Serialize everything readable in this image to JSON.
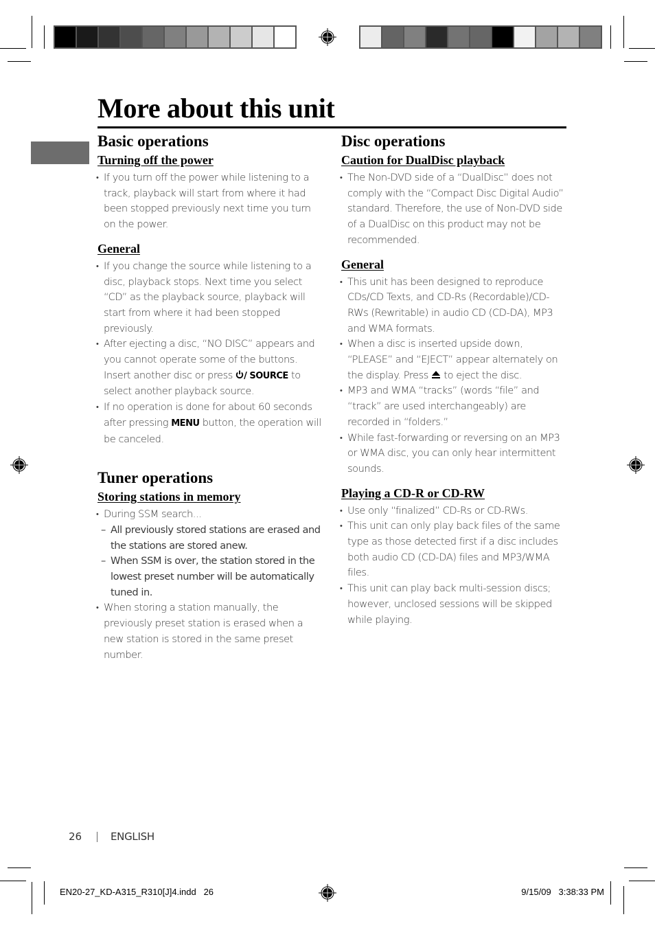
{
  "page": {
    "title": "More about this unit",
    "footer": {
      "page_number": "26",
      "language": "ENGLISH"
    },
    "slug": {
      "file": "EN20-27_KD-A315_R310[J]4.indd   26",
      "timestamp": "9/15/09   3:38:33 PM"
    }
  },
  "colorbars": {
    "left": [
      "#000000",
      "#1a1a1a",
      "#333333",
      "#4d4d4d",
      "#666666",
      "#808080",
      "#999999",
      "#b3b3b3",
      "#cccccc",
      "#e6e6e6",
      "#ffffff"
    ],
    "right": [
      "#ececec",
      "#646464",
      "#808080",
      "#2a2a2a",
      "#737373",
      "#666666",
      "#000000",
      "#f2f2f2",
      "#a3a3a3",
      "#b3b3b3",
      "#808080"
    ]
  },
  "left_column": {
    "basic": {
      "heading": "Basic operations",
      "turning_off": {
        "subheading": "Turning off the power",
        "items": [
          "If you turn off the power while listening to a track, playback will start from where it had been stopped previously next time you turn on the power."
        ]
      },
      "general": {
        "subheading": "General",
        "item1": "If you change the source while listening to a disc, playback stops. Next time you select “CD” as the playback source, playback will start from where it had been stopped previously.",
        "item2_pre": "After ejecting a disc, “NO DISC” appears and you cannot operate some of the buttons. Insert another disc or press ",
        "item2_icon": "power-icon",
        "item2_key": "/ SOURCE",
        "item2_post": " to select another playback source.",
        "item3_pre": "If no operation is done for about 60 seconds after pressing ",
        "item3_key": "MENU",
        "item3_post": " button, the operation will be canceled."
      }
    },
    "tuner": {
      "heading": "Tuner operations",
      "storing": {
        "subheading": "Storing stations in memory",
        "item1": "During SSM search...",
        "sub1": "All previously stored stations are erased and the stations are stored anew.",
        "sub2": "When SSM is over, the station stored in the lowest preset number will be automatically tuned in.",
        "item2": "When storing a station manually, the previously preset station is erased when a new station is stored in the same preset number."
      }
    }
  },
  "right_column": {
    "disc": {
      "heading": "Disc operations",
      "caution": {
        "subheading": "Caution for DualDisc playback",
        "items": [
          "The Non-DVD side of a “DualDisc” does not comply with the “Compact Disc Digital Audio” standard. Therefore, the use of Non-DVD side of a DualDisc on this product may not be recommended."
        ]
      },
      "general": {
        "subheading": "General",
        "item1": "This unit has been designed to reproduce CDs/CD Texts, and CD-Rs (Recordable)/CD-RWs (Rewritable) in audio CD (CD-DA), MP3 and WMA formats.",
        "item2_pre": "When a disc is inserted upside down, “PLEASE” and “EJECT” appear alternately on the display. Press ",
        "item2_icon": "eject-icon",
        "item2_post": " to eject the disc.",
        "item3": "MP3 and WMA “tracks” (words “file” and “track” are used interchangeably) are recorded in “folders.”",
        "item4": "While fast-forwarding or reversing on an MP3 or WMA disc, you can only hear intermittent sounds."
      },
      "cdr": {
        "subheading": "Playing a CD-R or CD-RW",
        "items": [
          "Use only “finalized” CD-Rs or CD-RWs.",
          "This unit can only play back files of the same type as those detected first if a disc includes both audio CD (CD-DA) files and MP3/WMA files.",
          "This unit can play back multi-session discs; however, unclosed sessions will be skipped while playing."
        ]
      }
    }
  }
}
